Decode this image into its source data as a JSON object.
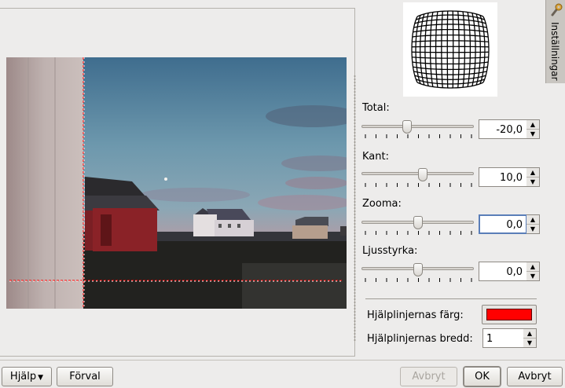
{
  "settings_tab": {
    "label": "Inställningar",
    "icon": "wrench-icon"
  },
  "preview": {
    "description_icon": "preview-image"
  },
  "sliders": [
    {
      "key": "total",
      "label": "Total:",
      "value": "-20,0",
      "level": 0.4
    },
    {
      "key": "kant",
      "label": "Kant:",
      "value": "10,0",
      "level": 0.55
    },
    {
      "key": "zooma",
      "label": "Zooma:",
      "value": "0,0",
      "level": 0.5
    },
    {
      "key": "ljusstyrka",
      "label": "Ljusstyrka:",
      "value": "0,0",
      "level": 0.5
    }
  ],
  "guide": {
    "color_label": "Hjälplinjernas färg:",
    "color_value": "#ff0000",
    "width_label": "Hjälplinjernas bredd:",
    "width_value": "1"
  },
  "buttons": {
    "help": "Hjälp",
    "reset": "Förval",
    "cancel_disabled": "Avbryt",
    "ok": "OK",
    "cancel": "Avbryt"
  },
  "colors": {
    "guide_line": "#ff0000",
    "focus": "#5a7eb8"
  }
}
